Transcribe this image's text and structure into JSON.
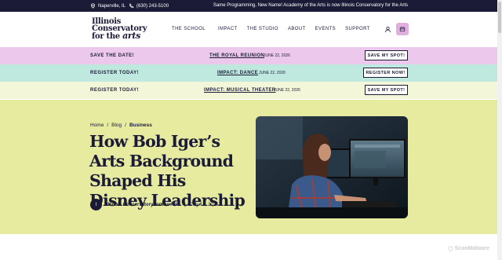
{
  "topbar": {
    "location": "Naperville, IL",
    "phone": "(630) 243-5100",
    "announcement": "Same Programming, New Name! Academy of the Arts is now Illinois Conservatory for the Arts"
  },
  "logo": {
    "line1": "Illinois",
    "line2": "Conservatory",
    "line3_prefix": "for the ",
    "line3_arts": "arts"
  },
  "nav": {
    "items": [
      "THE SCHOOL",
      "IMPACT",
      "THE STUDIO",
      "ABOUT",
      "EVENTS",
      "SUPPORT"
    ]
  },
  "bands": [
    {
      "label": "SAVE THE DATE!",
      "event": "THE ROYAL REUNION",
      "date": "JUNE 22, 2026",
      "button": "SAVE MY SPOT!"
    },
    {
      "label": "REGISTER TODAY!",
      "event": "IMPACT: DANCE",
      "date": "JUNE 22, 2026",
      "button": "REGISTER NOW!"
    },
    {
      "label": "REGISTER TODAY!",
      "event": "IMPACT: MUSICAL THEATER",
      "date": "JUNE 22, 2026",
      "button": "SAVE MY SPOT!"
    }
  ],
  "hero": {
    "breadcrumb": {
      "home": "Home",
      "blog": "Blog",
      "current": "Business",
      "separator": "/"
    },
    "title": "How Bob Iger’s Arts Background Shaped His Disney Leadership",
    "author_initial": "I",
    "author": "Illinois Conservatory for the Arts",
    "divider": "|",
    "date": "July 14, 2025"
  },
  "watermark": "ScanMalware",
  "colors": {
    "navy": "#1b1b37",
    "band_pink": "#ecc9ec",
    "band_teal": "#bfe9df",
    "band_cream": "#f3f6d9",
    "hero_bg": "#e6eb9f",
    "cart_pink": "#e1aee0"
  },
  "icons": {
    "location": "map-pin-icon",
    "phone": "phone-icon",
    "user": "user-icon",
    "cart": "cart-icon"
  }
}
